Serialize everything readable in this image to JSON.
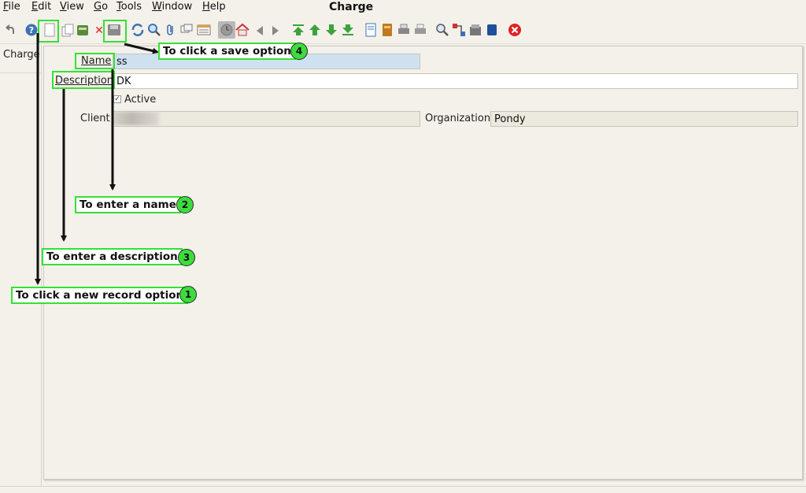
{
  "window_title": "Charge",
  "menu": [
    {
      "label": "File"
    },
    {
      "label": "Edit"
    },
    {
      "label": "View"
    },
    {
      "label": "Go"
    },
    {
      "label": "Tools"
    },
    {
      "label": "Window"
    },
    {
      "label": "Help"
    }
  ],
  "toolbar_icons": [
    "undo-icon",
    "help-icon",
    "new-record-icon",
    "copy-record-icon",
    "delete-selection-icon",
    "delete-icon",
    "save-icon",
    "refresh-icon",
    "find-icon",
    "attachment-icon",
    "chat-icon",
    "grid-toggle-icon",
    "history-icon",
    "home-icon",
    "back-icon",
    "forward-icon",
    "first-record-icon",
    "previous-record-icon",
    "next-record-icon",
    "last-record-icon",
    "report-icon",
    "archive-icon",
    "print-preview-icon",
    "print-icon",
    "zoom-across-icon",
    "workflow-icon",
    "product-info-icon",
    "process-icon",
    "exit-icon"
  ],
  "left_panel": {
    "label": "Charge"
  },
  "form": {
    "name_label": "Name",
    "name_value": "ss",
    "description_label": "Description",
    "description_value": "DK",
    "active_label": "Active",
    "active_checked": true,
    "client_label": "Client",
    "client_value": "",
    "organization_label": "Organization",
    "organization_value": "Pondy"
  },
  "annotations": [
    {
      "step": "1",
      "text": "To click a new record option"
    },
    {
      "step": "2",
      "text": "To enter a name"
    },
    {
      "step": "3",
      "text": "To enter a description"
    },
    {
      "step": "4",
      "text": "To click a save option"
    }
  ],
  "colors": {
    "highlight": "#35e135",
    "badge": "#3ddc3d",
    "mandatory_field": "#cfe1f1",
    "readonly_field": "#ece9df",
    "background": "#f4f1ea"
  }
}
